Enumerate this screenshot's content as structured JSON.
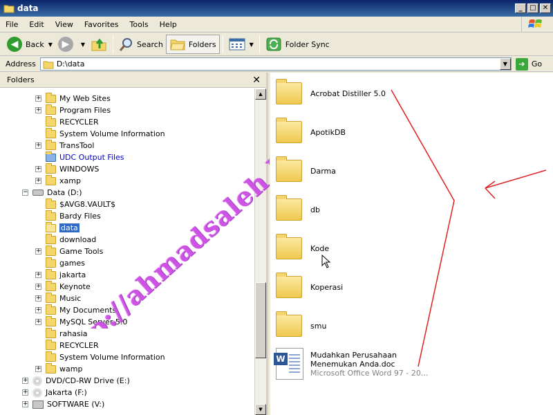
{
  "window": {
    "title": "data"
  },
  "menu": [
    "File",
    "Edit",
    "View",
    "Favorites",
    "Tools",
    "Help"
  ],
  "toolbar": {
    "back_label": "Back",
    "search_label": "Search",
    "folders_label": "Folders",
    "sync_label": "Folder Sync"
  },
  "address": {
    "label": "Address",
    "value": "D:\\data",
    "go_label": "Go"
  },
  "folders_pane": {
    "title": "Folders",
    "tree": [
      {
        "label": "My Web Sites",
        "icon": "folder",
        "expander": "+",
        "indent": 1
      },
      {
        "label": "Program Files",
        "icon": "folder",
        "expander": "+",
        "indent": 1
      },
      {
        "label": "RECYCLER",
        "icon": "folder",
        "expander": "",
        "indent": 1
      },
      {
        "label": "System Volume Information",
        "icon": "folder",
        "expander": "",
        "indent": 1
      },
      {
        "label": "TransTool",
        "icon": "folder",
        "expander": "+",
        "indent": 1
      },
      {
        "label": "UDC Output Files",
        "icon": "special-folder",
        "expander": "",
        "indent": 1,
        "style": "blue"
      },
      {
        "label": "WINDOWS",
        "icon": "folder",
        "expander": "+",
        "indent": 1
      },
      {
        "label": "xamp",
        "icon": "folder",
        "expander": "+",
        "indent": 1
      },
      {
        "label": "Data (D:)",
        "icon": "drive",
        "expander": "-",
        "indent": 0
      },
      {
        "label": "$AVG8.VAULT$",
        "icon": "folder",
        "expander": "",
        "indent": 1
      },
      {
        "label": "Bardy Files",
        "icon": "folder",
        "expander": "",
        "indent": 1
      },
      {
        "label": "data",
        "icon": "open-folder",
        "expander": "",
        "indent": 1,
        "style": "selected"
      },
      {
        "label": "download",
        "icon": "folder",
        "expander": "",
        "indent": 1
      },
      {
        "label": "Game Tools",
        "icon": "folder",
        "expander": "+",
        "indent": 1
      },
      {
        "label": "games",
        "icon": "folder",
        "expander": "",
        "indent": 1
      },
      {
        "label": "jakarta",
        "icon": "folder",
        "expander": "+",
        "indent": 1
      },
      {
        "label": "Keynote",
        "icon": "folder",
        "expander": "+",
        "indent": 1
      },
      {
        "label": "Music",
        "icon": "folder",
        "expander": "+",
        "indent": 1
      },
      {
        "label": "My Documents",
        "icon": "folder",
        "expander": "+",
        "indent": 1
      },
      {
        "label": "MySQL Server 5.0",
        "icon": "folder",
        "expander": "+",
        "indent": 1
      },
      {
        "label": "rahasia",
        "icon": "folder",
        "expander": "",
        "indent": 1
      },
      {
        "label": "RECYCLER",
        "icon": "folder",
        "expander": "",
        "indent": 1
      },
      {
        "label": "System Volume Information",
        "icon": "folder",
        "expander": "",
        "indent": 1
      },
      {
        "label": "wamp",
        "icon": "folder",
        "expander": "+",
        "indent": 1
      },
      {
        "label": "DVD/CD-RW Drive (E:)",
        "icon": "cd",
        "expander": "+",
        "indent": 0
      },
      {
        "label": "Jakarta (F:)",
        "icon": "cd",
        "expander": "+",
        "indent": 0
      },
      {
        "label": "SOFTWARE (V:)",
        "icon": "net",
        "expander": "+",
        "indent": 0
      }
    ]
  },
  "content": {
    "folders": [
      "Acrobat Distiller 5.0",
      "ApotikDB",
      "Darma",
      "db",
      "Kode",
      "Koperasi",
      "smu"
    ],
    "document": {
      "name_line1": "Mudahkan Perusahaan",
      "name_line2": "Menemukan Anda.doc",
      "type": "Microsoft Office Word 97 - 20..."
    }
  },
  "watermark": "http://ahmadsaleh.blogspot.com",
  "colors": {
    "annotation": "#e02020",
    "watermark": "#dc5af0",
    "selection": "#316ac5"
  }
}
